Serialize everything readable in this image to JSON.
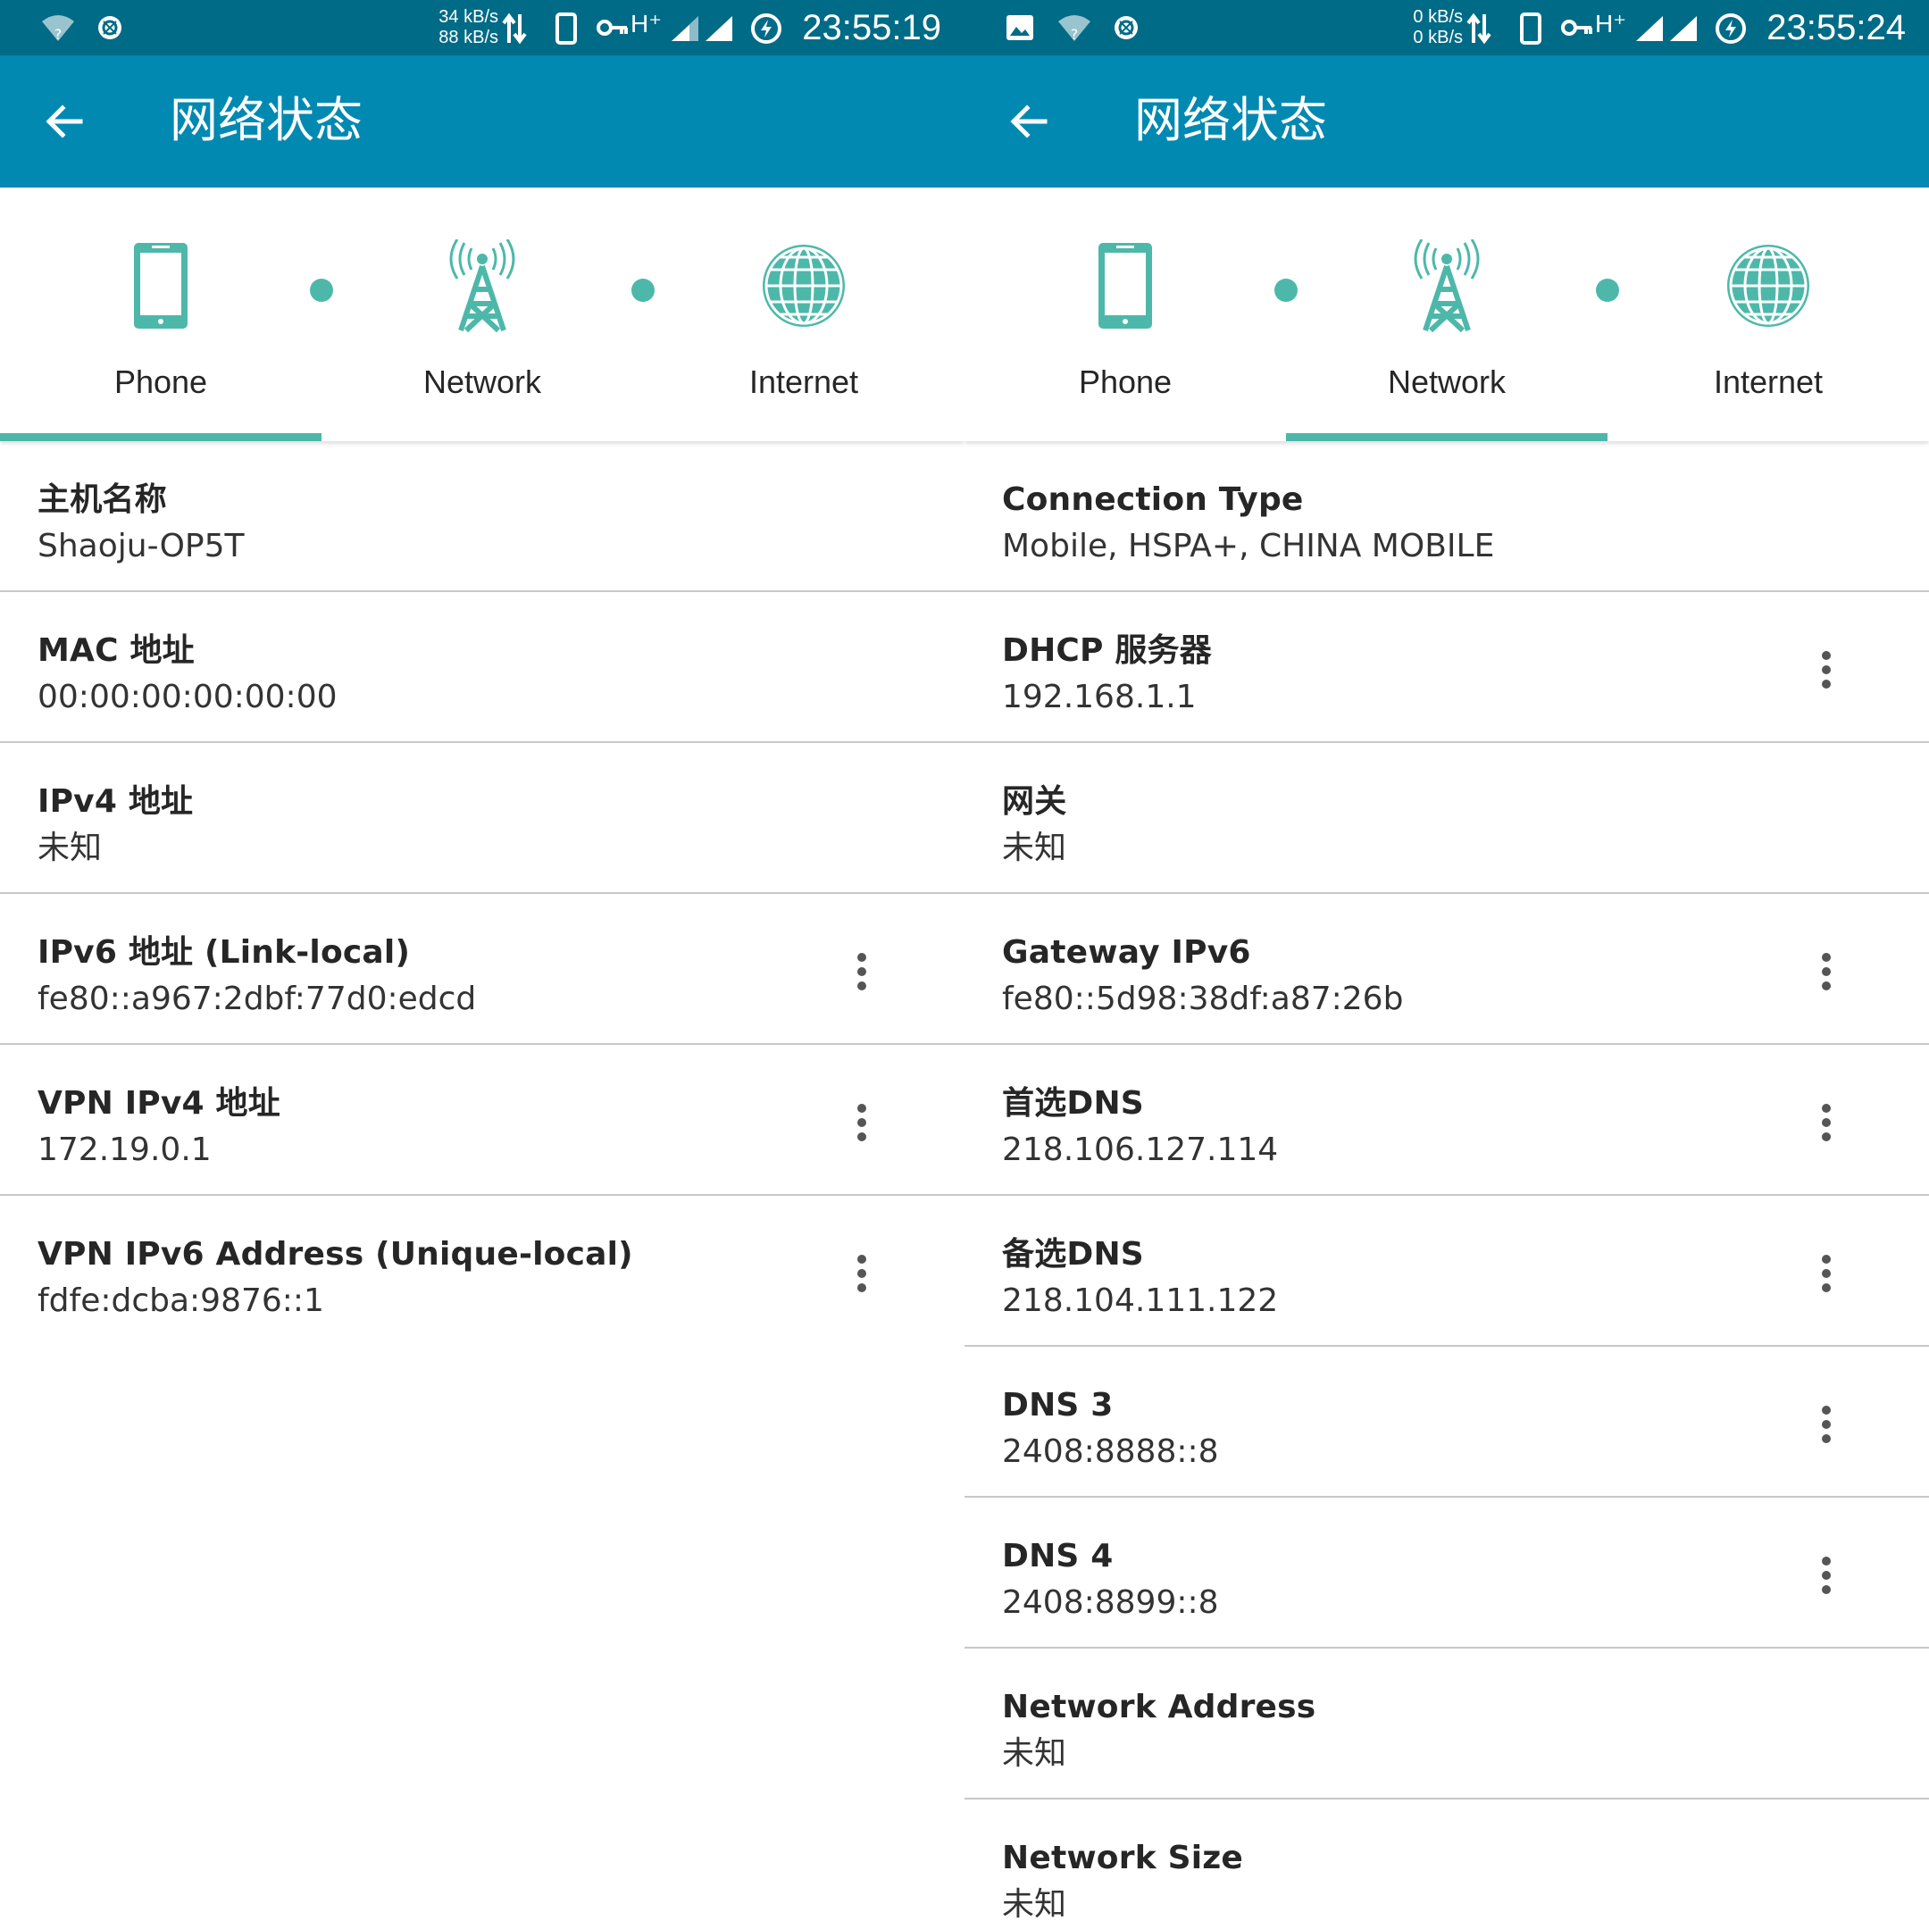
{
  "colors": {
    "status_bar": "#006b86",
    "app_bar": "#0289b1",
    "accent": "#4db8aa",
    "divider": "#c8c8c8"
  },
  "left": {
    "status_bar": {
      "speed_up": "34 kB/s",
      "speed_down": "88 kB/s",
      "network_type": "H⁺",
      "time": "23:55:19"
    },
    "app_bar": {
      "title": "网络状态"
    },
    "tabs": [
      {
        "label": "Phone",
        "icon": "phone-icon",
        "selected": true
      },
      {
        "label": "Network",
        "icon": "cell-tower-icon",
        "selected": false
      },
      {
        "label": "Internet",
        "icon": "globe-icon",
        "selected": false
      }
    ],
    "items": [
      {
        "label": "主机名称",
        "value": "Shaoju-OP5T",
        "has_menu": false
      },
      {
        "label": "MAC 地址",
        "value": "00:00:00:00:00:00",
        "has_menu": false
      },
      {
        "label": "IPv4 地址",
        "value": "未知",
        "has_menu": false
      },
      {
        "label": "IPv6 地址 (Link-local)",
        "value": "fe80::a967:2dbf:77d0:edcd",
        "has_menu": true
      },
      {
        "label": "VPN IPv4 地址",
        "value": "172.19.0.1",
        "has_menu": true
      },
      {
        "label": "VPN IPv6 Address (Unique-local)",
        "value": "fdfe:dcba:9876::1",
        "has_menu": true
      }
    ]
  },
  "right": {
    "status_bar": {
      "speed_up": "0 kB/s",
      "speed_down": "0 kB/s",
      "network_type": "H⁺",
      "time": "23:55:24"
    },
    "app_bar": {
      "title": "网络状态"
    },
    "tabs": [
      {
        "label": "Phone",
        "icon": "phone-icon",
        "selected": false
      },
      {
        "label": "Network",
        "icon": "cell-tower-icon",
        "selected": true
      },
      {
        "label": "Internet",
        "icon": "globe-icon",
        "selected": false
      }
    ],
    "items": [
      {
        "label": "Connection Type",
        "value": "Mobile, HSPA+, CHINA MOBILE",
        "has_menu": false
      },
      {
        "label": "DHCP 服务器",
        "value": "192.168.1.1",
        "has_menu": true
      },
      {
        "label": "网关",
        "value": "未知",
        "has_menu": false
      },
      {
        "label": "Gateway IPv6",
        "value": "fe80::5d98:38df:a87:26b",
        "has_menu": true
      },
      {
        "label": "首选DNS",
        "value": "218.106.127.114",
        "has_menu": true
      },
      {
        "label": "备选DNS",
        "value": "218.104.111.122",
        "has_menu": true
      },
      {
        "label": "DNS 3",
        "value": "2408:8888::8",
        "has_menu": true
      },
      {
        "label": "DNS 4",
        "value": "2408:8899::8",
        "has_menu": true
      },
      {
        "label": "Network Address",
        "value": "未知",
        "has_menu": false
      },
      {
        "label": "Network Size",
        "value": "未知",
        "has_menu": false
      }
    ]
  }
}
